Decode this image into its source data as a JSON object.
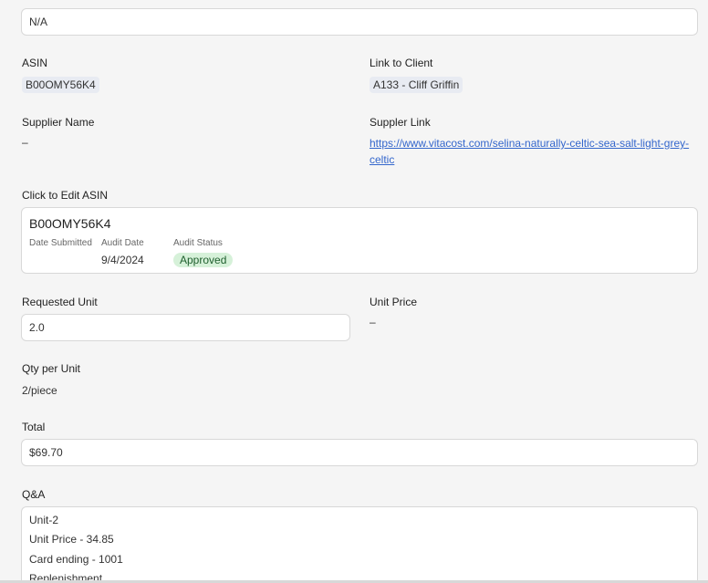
{
  "top_field": {
    "value": "N/A"
  },
  "asin": {
    "label": "ASIN",
    "value": "B00OMY56K4"
  },
  "link_to_client": {
    "label": "Link to Client",
    "value": "A133 - Cliff Griffin"
  },
  "supplier_name": {
    "label": "Supplier Name",
    "value": "–"
  },
  "supplier_link": {
    "label": "Suppler Link",
    "line1": "https://www.vitacost.com/selina-naturally-celtic-sea-salt-light-grey-",
    "line2": "celtic"
  },
  "edit_asin": {
    "label": "Click to Edit ASIN",
    "card": {
      "asin": "B00OMY56K4",
      "date_submitted_label": "Date Submitted",
      "audit_date_label": "Audit Date",
      "audit_date_value": "9/4/2024",
      "audit_status_label": "Audit Status",
      "audit_status_value": "Approved",
      "status_color": "#d6f1d9"
    }
  },
  "requested_unit": {
    "label": "Requested Unit",
    "value": "2.0"
  },
  "unit_price": {
    "label": "Unit Price",
    "value": "–"
  },
  "qty_per_unit": {
    "label": "Qty per Unit",
    "value": "2/piece"
  },
  "total": {
    "label": "Total",
    "value": "$69.70"
  },
  "qa": {
    "label": "Q&A",
    "lines": [
      "Unit-2",
      "Unit Price - 34.85",
      "Card ending - 1001",
      "Replenishment"
    ]
  },
  "colors": {
    "link": "#3366cc",
    "chip_bg": "#e8ebf2",
    "page_bg": "#f5f5f5"
  }
}
